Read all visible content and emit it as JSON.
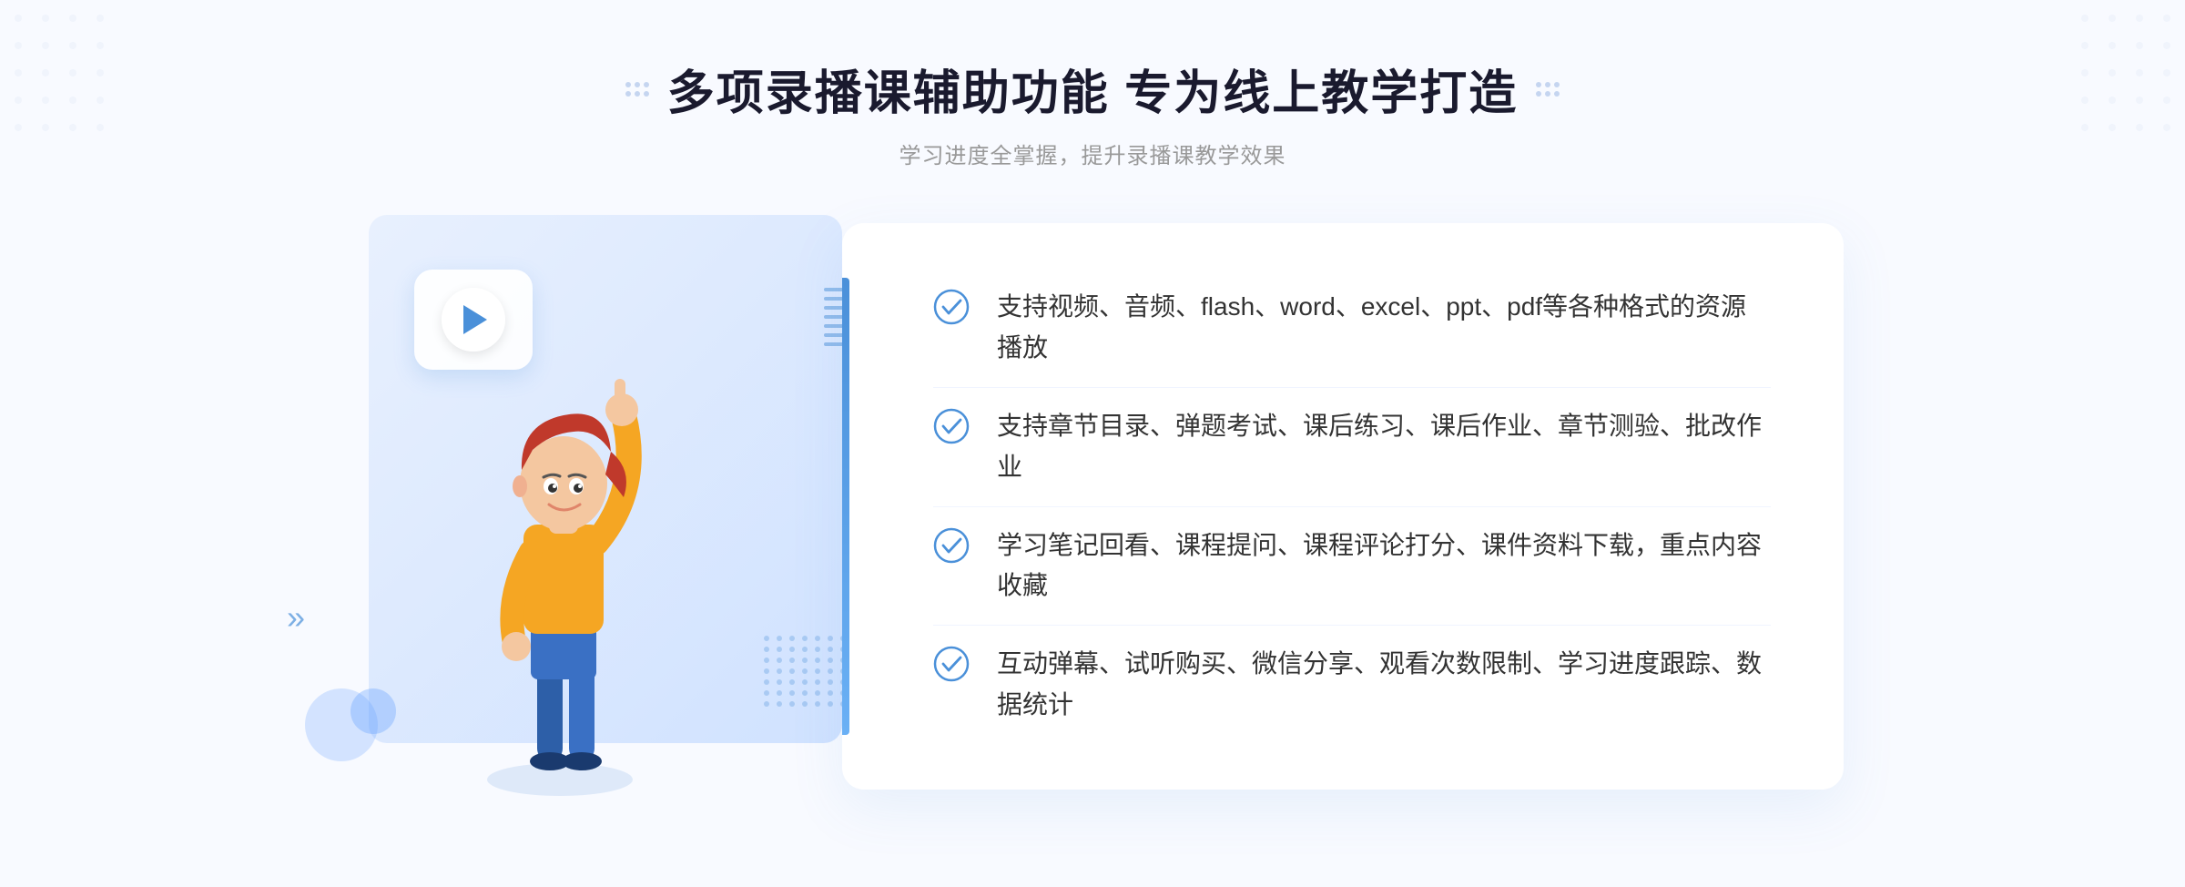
{
  "header": {
    "title": "多项录播课辅助功能 专为线上教学打造",
    "subtitle": "学习进度全掌握，提升录播课教学效果"
  },
  "features": [
    {
      "id": 1,
      "text": "支持视频、音频、flash、word、excel、ppt、pdf等各种格式的资源播放"
    },
    {
      "id": 2,
      "text": "支持章节目录、弹题考试、课后练习、课后作业、章节测验、批改作业"
    },
    {
      "id": 3,
      "text": "学习笔记回看、课程提问、课程评论打分、课件资料下载，重点内容收藏"
    },
    {
      "id": 4,
      "text": "互动弹幕、试听购买、微信分享、观看次数限制、学习进度跟踪、数据统计"
    }
  ],
  "colors": {
    "accent": "#4a90d9",
    "title": "#1a1a2e",
    "subtitle": "#999999",
    "text": "#333333",
    "check": "#4a90d9"
  },
  "decorations": {
    "chevron_left": "«"
  }
}
